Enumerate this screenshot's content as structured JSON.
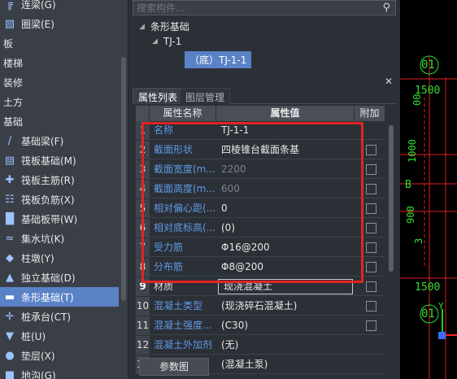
{
  "left_tree": {
    "items": [
      {
        "label": "连梁(G)",
        "icon": "link-beam-icon",
        "type": "sub"
      },
      {
        "label": "圈梁(E)",
        "icon": "ring-beam-icon",
        "type": "sub"
      },
      {
        "label": "板",
        "type": "cat"
      },
      {
        "label": "楼梯",
        "type": "cat"
      },
      {
        "label": "装修",
        "type": "cat"
      },
      {
        "label": "土方",
        "type": "cat"
      },
      {
        "label": "基础",
        "type": "cat"
      },
      {
        "label": "基础梁(F)",
        "icon": "foundation-beam-icon",
        "type": "sub"
      },
      {
        "label": "筏板基础(M)",
        "icon": "raft-foundation-icon",
        "type": "sub"
      },
      {
        "label": "筏板主筋(R)",
        "icon": "raft-main-rebar-icon",
        "type": "sub"
      },
      {
        "label": "筏板负筋(X)",
        "icon": "raft-negative-rebar-icon",
        "type": "sub"
      },
      {
        "label": "基础板带(W)",
        "icon": "foundation-strip-icon",
        "type": "sub"
      },
      {
        "label": "集水坑(K)",
        "icon": "sump-pit-icon",
        "type": "sub"
      },
      {
        "label": "柱墩(Y)",
        "icon": "column-pier-icon",
        "type": "sub"
      },
      {
        "label": "独立基础(D)",
        "icon": "isolated-footing-icon",
        "type": "sub"
      },
      {
        "label": "条形基础(T)",
        "icon": "strip-footing-icon",
        "type": "sub",
        "selected": true
      },
      {
        "label": "桩承台(CT)",
        "icon": "pile-cap-icon",
        "type": "sub"
      },
      {
        "label": "桩(U)",
        "icon": "pile-icon",
        "type": "sub"
      },
      {
        "label": "垫层(X)",
        "icon": "cushion-layer-icon",
        "type": "sub"
      },
      {
        "label": "地沟(G)",
        "icon": "trench-icon",
        "type": "sub"
      }
    ]
  },
  "search": {
    "placeholder": "搜索构件..."
  },
  "component_tree": {
    "root": "条形基础",
    "child": "TJ-1",
    "leaf": "（底）TJ-1-1"
  },
  "tabs": {
    "active": "属性列表",
    "inactive": "图层管理"
  },
  "grid": {
    "headers": {
      "name": "属性名称",
      "value": "属性值",
      "extra": "附加"
    },
    "rows": [
      {
        "num": "1",
        "name": "名称",
        "value": "TJ-1-1",
        "check": false
      },
      {
        "num": "2",
        "name": "截面形状",
        "value": "四棱锥台截面条基",
        "check": true
      },
      {
        "num": "3",
        "name": "截面宽度(m...",
        "value": "2200",
        "check": true,
        "dim": true
      },
      {
        "num": "4",
        "name": "截面高度(m...",
        "value": "600",
        "check": true,
        "dim": true
      },
      {
        "num": "5",
        "name": "相对偏心距(...",
        "value": "0",
        "check": true
      },
      {
        "num": "6",
        "name": "相对底标高(...",
        "value": "(0)",
        "check": true
      },
      {
        "num": "7",
        "name": "受力筋",
        "value": "Φ16@200",
        "check": true
      },
      {
        "num": "8",
        "name": "分布筋",
        "value": "Φ8@200",
        "check": true
      },
      {
        "num": "9",
        "name": "材质",
        "value": "现浇混凝土",
        "check": true,
        "editing": true,
        "gray_name": true
      },
      {
        "num": "10",
        "name": "混凝土类型",
        "value": "(现浇碎石混凝土)",
        "check": true
      },
      {
        "num": "11",
        "name": "混凝土强度...",
        "value": "(C30)",
        "check": true
      },
      {
        "num": "12",
        "name": "混凝土外加剂",
        "value": "(无)",
        "check": false
      },
      {
        "num": "13",
        "name": "泵送类型",
        "value": "(混凝土泵)",
        "check": false
      }
    ]
  },
  "param_button": "参数图",
  "cad": {
    "labels": [
      "01",
      "1500",
      "00",
      "1000",
      "B",
      "900",
      "3",
      "1500",
      "01",
      "Y"
    ],
    "colors": {
      "grid_line": "#e02020",
      "label": "#33dd33",
      "axis_x": "#ff2222",
      "axis_y": "#22cc22"
    }
  },
  "colors": {
    "accent": "#5a82c6",
    "highlight_box": "#e02424",
    "link_text": "#5f9ae6"
  }
}
